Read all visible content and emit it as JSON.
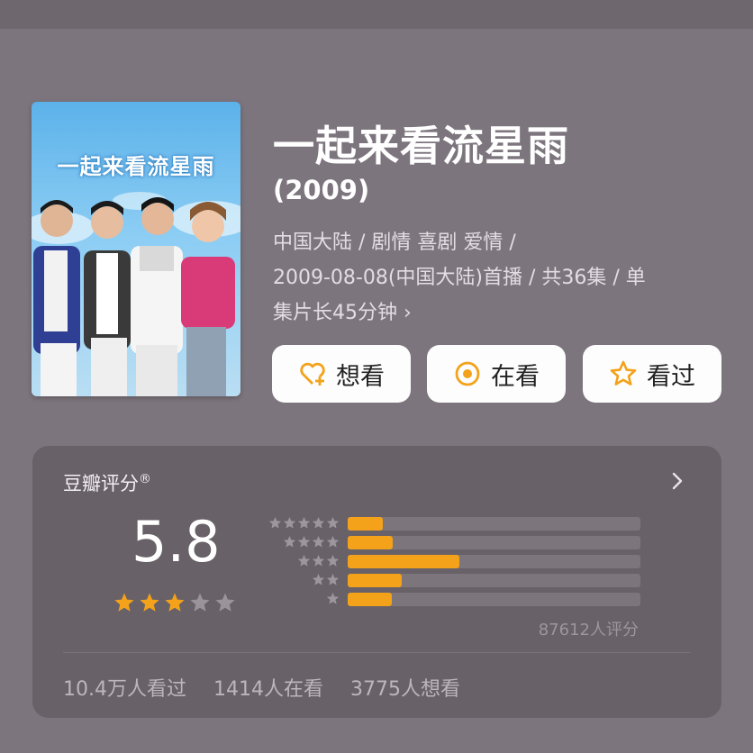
{
  "title": "一起来看流星雨",
  "year": "(2009)",
  "poster": {
    "logo_text": "一起来看流星雨"
  },
  "meta": {
    "line1": "中国大陆 / 剧情 喜剧 爱情 /",
    "line2": "2009-08-08(中国大陆)首播 / 共36集 / 单",
    "line3": "集片长45分钟 ›"
  },
  "buttons": {
    "want": "想看",
    "watching": "在看",
    "watched": "看过"
  },
  "rating": {
    "label": "豆瓣评分",
    "reg_mark": "®",
    "score": "5.8",
    "stars_filled": 3,
    "stars_total": 5,
    "count": "87612人评分",
    "distribution": [
      {
        "stars": 5,
        "fraction": 0.12
      },
      {
        "stars": 4,
        "fraction": 0.155
      },
      {
        "stars": 3,
        "fraction": 0.38
      },
      {
        "stars": 2,
        "fraction": 0.185
      },
      {
        "stars": 1,
        "fraction": 0.15
      }
    ]
  },
  "stats": {
    "watched": "10.4万人看过",
    "watching": "1414人在看",
    "want": "3775人想看"
  },
  "colors": {
    "background": "#7d757d",
    "card": "#686168",
    "accent": "#f3a21a",
    "button_bg": "#fdfdfd"
  },
  "icons": {
    "want": "heart-plus-icon",
    "watching": "target-circle-icon",
    "watched": "star-outline-icon",
    "chevron": "chevron-right-icon"
  }
}
